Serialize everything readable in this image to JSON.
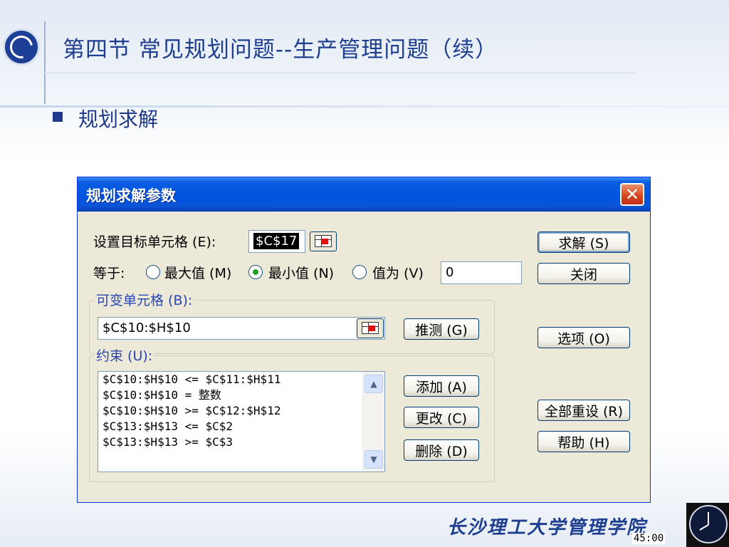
{
  "slide": {
    "title": "第四节  常见规划问题--生产管理问题（续）",
    "bullet": "规划求解",
    "footer": "长沙理工大学管理学院",
    "timer": "45:00"
  },
  "dialog": {
    "title": "规划求解参数",
    "target_label": "设置目标单元格 (E):",
    "target_value": "$C$17",
    "equal_label": "等于:",
    "radio_max": "最大值 (M)",
    "radio_min": "最小值 (N)",
    "radio_value": "值为 (V)",
    "value_of": "0",
    "selected_radio": "min",
    "changing_label": "可变单元格 (B):",
    "changing_value": "$C$10:$H$10",
    "guess_button": "推测 (G)",
    "constraints_label": "约束 (U):",
    "constraints": [
      "$C$10:$H$10 <= $C$11:$H$11",
      "$C$10:$H$10 = 整数",
      "$C$10:$H$10 >= $C$12:$H$12",
      "$C$13:$H$13 <= $C$2",
      "$C$13:$H$13 >= $C$3"
    ],
    "add_button": "添加 (A)",
    "change_button": "更改 (C)",
    "delete_button": "删除 (D)",
    "solve_button": "求解 (S)",
    "close_button": "关闭",
    "options_button": "选项 (O)",
    "reset_button": "全部重设 (R)",
    "help_button": "帮助 (H)"
  },
  "colors": {
    "title_blue": "#1e3e8f",
    "dialog_titlebar": "#0053e0",
    "dialog_body": "#ece9d8",
    "close_red": "#d4441d"
  }
}
